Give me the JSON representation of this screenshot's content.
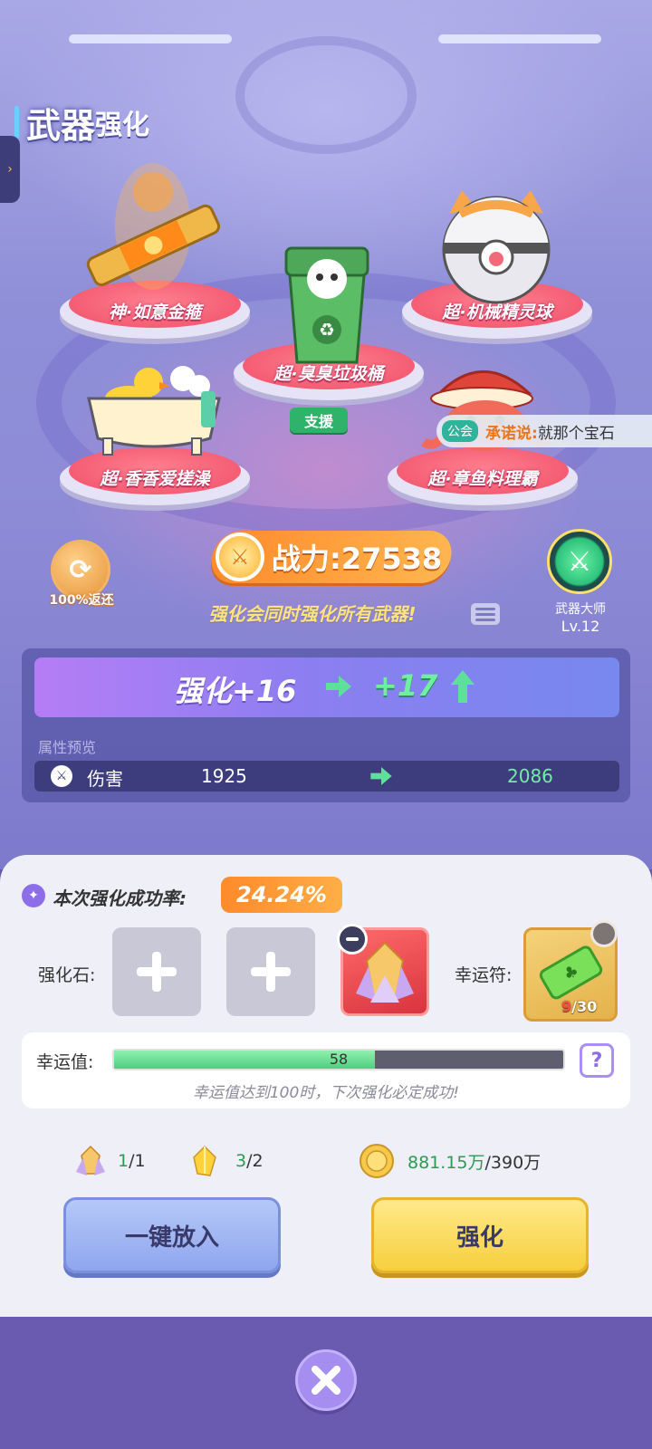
{
  "header": {
    "title_big": "武器",
    "title_small": "强化"
  },
  "weapons": [
    {
      "label": "神·如意金箍"
    },
    {
      "label": "超·臭臭垃圾桶"
    },
    {
      "label": "超·机械精灵球"
    },
    {
      "label": "超·香香爱搓澡"
    },
    {
      "label": "超·章鱼料理霸"
    }
  ],
  "support_badge": "支援",
  "chat": {
    "tag": "公会",
    "name": "承诺说:",
    "message": "就那个宝石"
  },
  "refund": {
    "label": "100%返还"
  },
  "power": {
    "label": "战力:",
    "value": "27538"
  },
  "hint": "强化会同时强化所有武器!",
  "master": {
    "name": "武器大师",
    "level": "Lv.12"
  },
  "enhance": {
    "from": "强化+16",
    "to": "+17"
  },
  "attributes": {
    "title": "属性预览",
    "rows": [
      {
        "name": "伤害",
        "from": "1925",
        "to": "2086"
      }
    ]
  },
  "success_rate": {
    "label": "本次强化成功率:",
    "value": "24.24%"
  },
  "stones": {
    "label": "强化石:"
  },
  "lucky_charm": {
    "label": "幸运符:",
    "count_current": "9",
    "count_total": "/30"
  },
  "luck": {
    "label": "幸运值:",
    "value": 58,
    "max": 100,
    "value_text": "58",
    "hint": "幸运值达到100时，下次强化必定成功!"
  },
  "costs": {
    "crystal": {
      "have": "1",
      "need": "/1"
    },
    "gem": {
      "have": "3",
      "need": "/2"
    },
    "gold": {
      "have": "881.15万",
      "need": "/390万"
    }
  },
  "buttons": {
    "auto_fill": "一键放入",
    "enhance": "强化"
  },
  "colors": {
    "accent_orange": "#ff8a2a",
    "accent_green": "#6ff0a0",
    "primary_purple": "#8d6ee8"
  }
}
